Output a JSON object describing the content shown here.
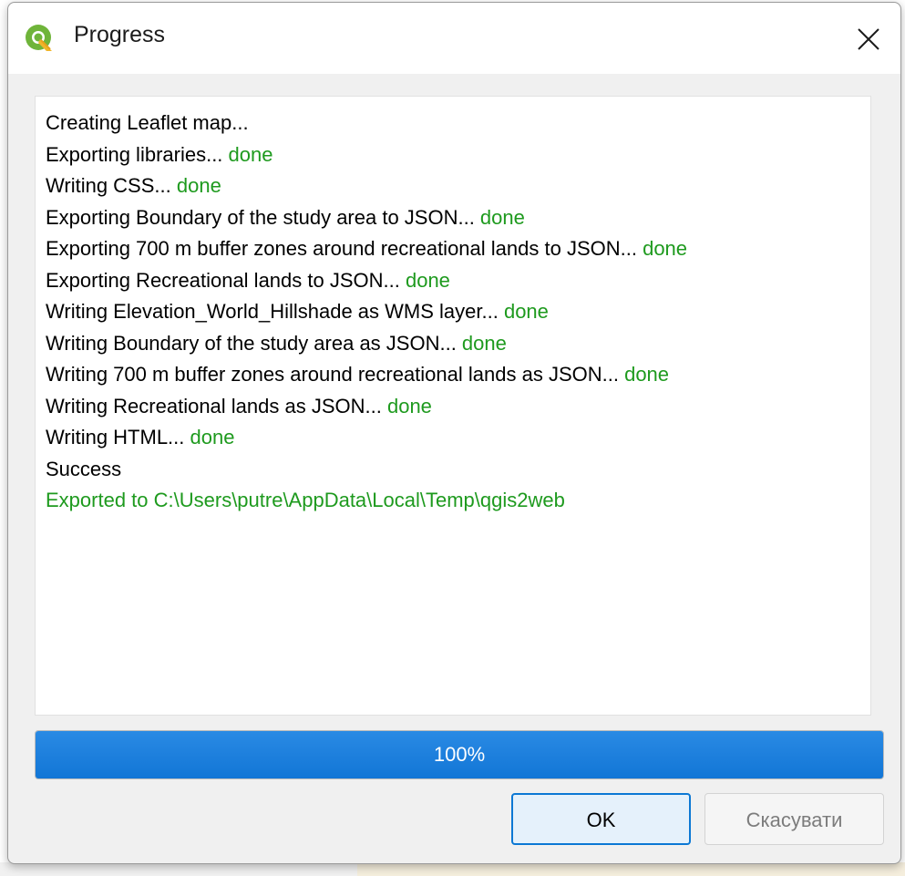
{
  "window": {
    "title": "Progress",
    "app_icon": "qgis-logo-icon",
    "close_icon": "close-icon"
  },
  "log": {
    "lines": [
      {
        "text": "Creating Leaflet map...",
        "status": ""
      },
      {
        "text": "Exporting libraries... ",
        "status": "done"
      },
      {
        "text": "Writing CSS... ",
        "status": "done"
      },
      {
        "text": "Exporting Boundary of the study area to JSON... ",
        "status": "done"
      },
      {
        "text": "Exporting 700 m buffer zones around recreational lands to JSON... ",
        "status": "done"
      },
      {
        "text": "Exporting Recreational lands to JSON... ",
        "status": "done"
      },
      {
        "text": "Writing Elevation_World_Hillshade as WMS layer... ",
        "status": "done"
      },
      {
        "text": "Writing Boundary of the study area as JSON... ",
        "status": "done"
      },
      {
        "text": "Writing 700 m buffer zones around recreational lands as JSON... ",
        "status": "done"
      },
      {
        "text": "Writing Recreational lands as JSON... ",
        "status": "done"
      },
      {
        "text": "Writing HTML... ",
        "status": "done"
      },
      {
        "text": "Success",
        "status": ""
      },
      {
        "text": "",
        "status": "Exported to C:\\Users\\putre\\AppData\\Local\\Temp\\qgis2web"
      }
    ]
  },
  "progress": {
    "value": 1.0,
    "label": "100%"
  },
  "buttons": {
    "ok_label": "OK",
    "cancel_label": "Скасувати"
  },
  "colors": {
    "status_green": "#1e9a1e",
    "progress_blue": "#1276d6",
    "focus_border": "#0b78d4"
  }
}
